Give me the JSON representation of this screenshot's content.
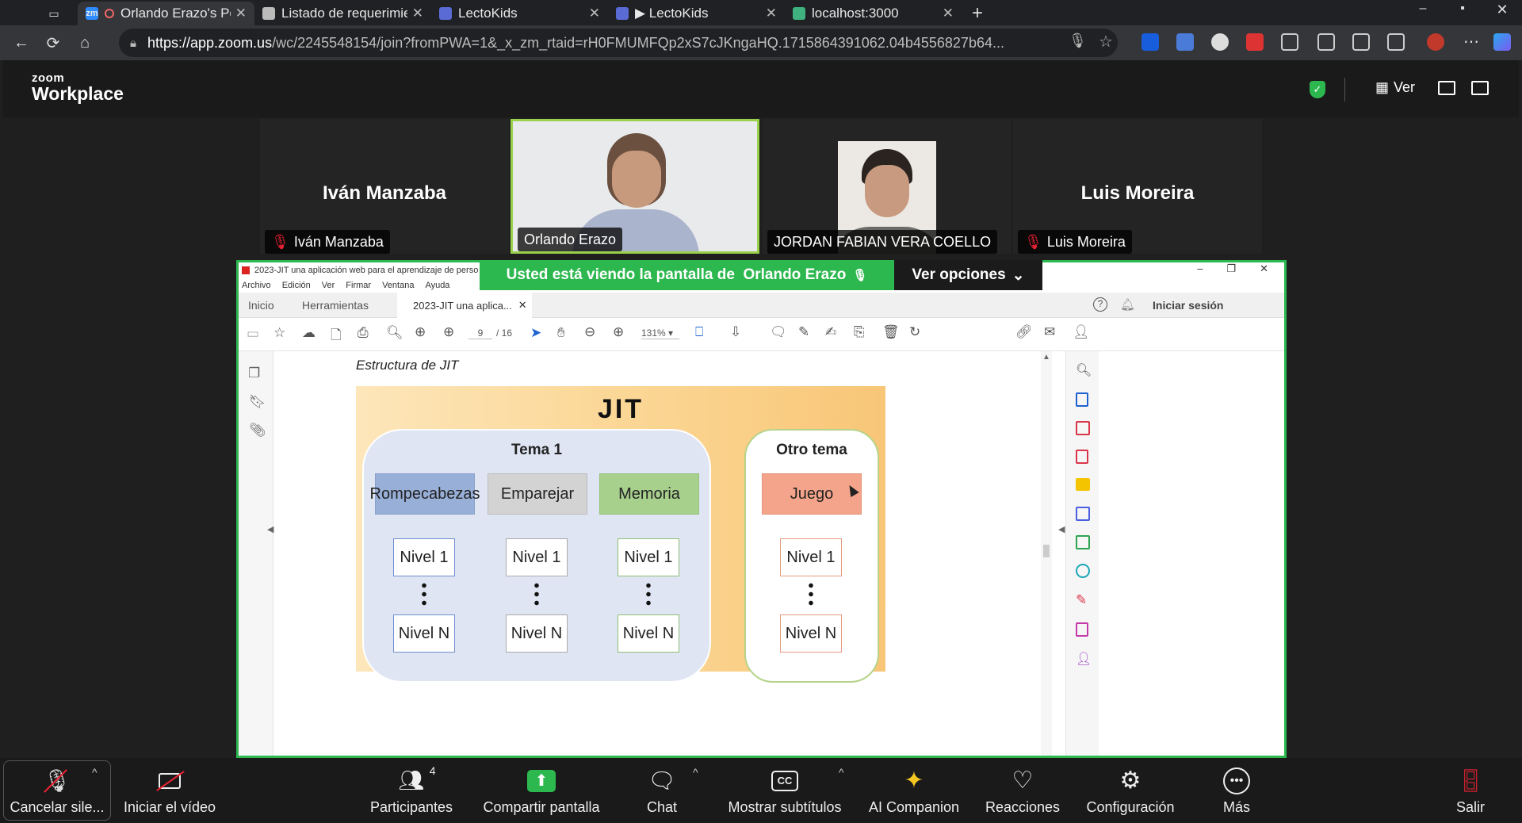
{
  "browser": {
    "tabs": [
      {
        "label": "Orlando Erazo's Pe",
        "fav": "zm",
        "favcolor": "#2d8cff",
        "active": true,
        "recording": true
      },
      {
        "label": "Listado de requerimien",
        "fav": "",
        "favcolor": "#bbb",
        "active": false
      },
      {
        "label": "LectoKids",
        "fav": "",
        "favcolor": "#5b6bd6",
        "active": false
      },
      {
        "label": "▶ LectoKids",
        "fav": "",
        "favcolor": "#5b6bd6",
        "active": false
      },
      {
        "label": "localhost:3000",
        "fav": "",
        "favcolor": "#3fb27f",
        "active": false
      }
    ],
    "url_host": "https://app.zoom.us",
    "url_rest": "/wc/2245548154/join?fromPWA=1&_x_zm_rtaid=rH0FMUMFQp2xS7cJKngaHQ.1715864391062.04b4556827b64..."
  },
  "zoom": {
    "logo_top": "zoom",
    "logo_bottom": "Workplace",
    "view_label": "Ver",
    "participants": [
      {
        "center_name": "Iván Manzaba",
        "label": "Iván Manzaba",
        "muted": true,
        "video": false
      },
      {
        "center_name": "",
        "label": "Orlando Erazo",
        "muted": false,
        "video": true
      },
      {
        "center_name": "",
        "label": "JORDAN FABIAN VERA COELLO",
        "muted": false,
        "video": true
      },
      {
        "center_name": "Luis Moreira",
        "label": "Luis Moreira",
        "muted": true,
        "video": false
      }
    ],
    "banner": {
      "prefix": "Usted está viendo la pantalla de",
      "presenter": "Orlando Erazo",
      "options": "Ver opciones"
    },
    "toolbar": {
      "mute": "Cancelar sile...",
      "video": "Iniciar el vídeo",
      "participants": "Participantes",
      "participants_count": "4",
      "share": "Compartir pantalla",
      "chat": "Chat",
      "captions": "Mostrar subtítulos",
      "ai": "AI Companion",
      "reactions": "Reacciones",
      "settings": "Configuración",
      "more": "Más",
      "leave": "Salir"
    }
  },
  "acrobat": {
    "title": "2023-JIT una aplicación web para el aprendizaje de perso",
    "menu": [
      "Archivo",
      "Edición",
      "Ver",
      "Firmar",
      "Ventana",
      "Ayuda"
    ],
    "tab_home": "Inicio",
    "tab_tools": "Herramientas",
    "tab_doc": "2023-JIT una aplica...",
    "signin": "Iniciar sesión",
    "page_current": "9",
    "page_total": "/ 16",
    "zoom": "131%"
  },
  "document": {
    "figure_caption": "Estructura de JIT",
    "diagram": {
      "title": "JIT",
      "group1_title": "Tema 1",
      "group2_title": "Otro tema",
      "games": [
        "Rompecabezas",
        "Emparejar",
        "Memoria",
        "Juego"
      ],
      "level_first": "Nivel 1",
      "level_last": "Nivel N"
    }
  }
}
